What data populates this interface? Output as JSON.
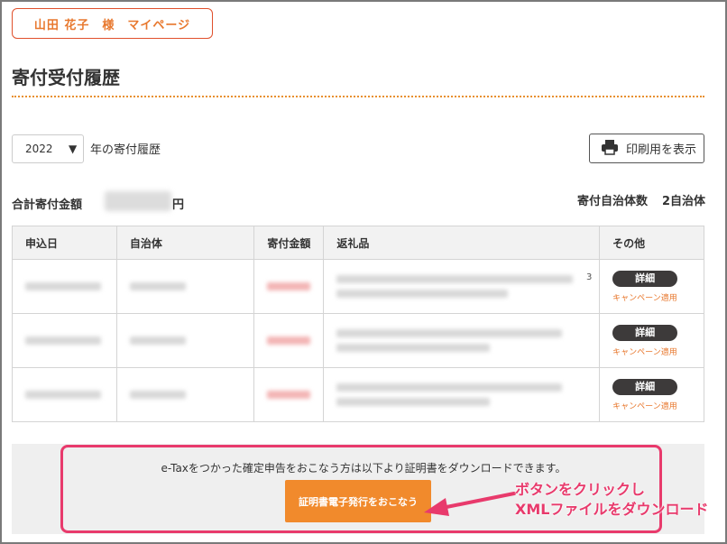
{
  "header": {
    "mypage_label": "山田 花子　様　マイページ"
  },
  "page": {
    "title": "寄付受付履歴"
  },
  "filter": {
    "year_value": "2022",
    "year_caption": "年の寄付履歴",
    "print_label": "印刷用を表示"
  },
  "summary": {
    "total_label": "合計寄付金額",
    "total_unit": "円",
    "municipality_count_label": "寄付自治体数",
    "municipality_count_value": "2自治体"
  },
  "table": {
    "headers": [
      "申込日",
      "自治体",
      "寄付金額",
      "返礼品",
      "その他"
    ],
    "rows": [
      {
        "detail_label": "詳細",
        "campaign_label": "キャンペーン適用"
      },
      {
        "detail_label": "詳細",
        "campaign_label": "キャンペーン適用"
      },
      {
        "detail_label": "詳細",
        "campaign_label": "キャンペーン適用"
      }
    ],
    "row1_stray": "3"
  },
  "etax": {
    "notice": "e-Taxをつかった確定申告をおこなう方は以下より証明書をダウンロードできます。",
    "button_label": "証明書電子発行をおこなう"
  },
  "annotation": {
    "line1": "ボタンをクリックし",
    "line2": "XMLファイルをダウンロード",
    "color": "#e83a6c"
  },
  "colors": {
    "accent": "#e8782e",
    "button": "#f18a2c",
    "highlight": "#e83a6c"
  }
}
